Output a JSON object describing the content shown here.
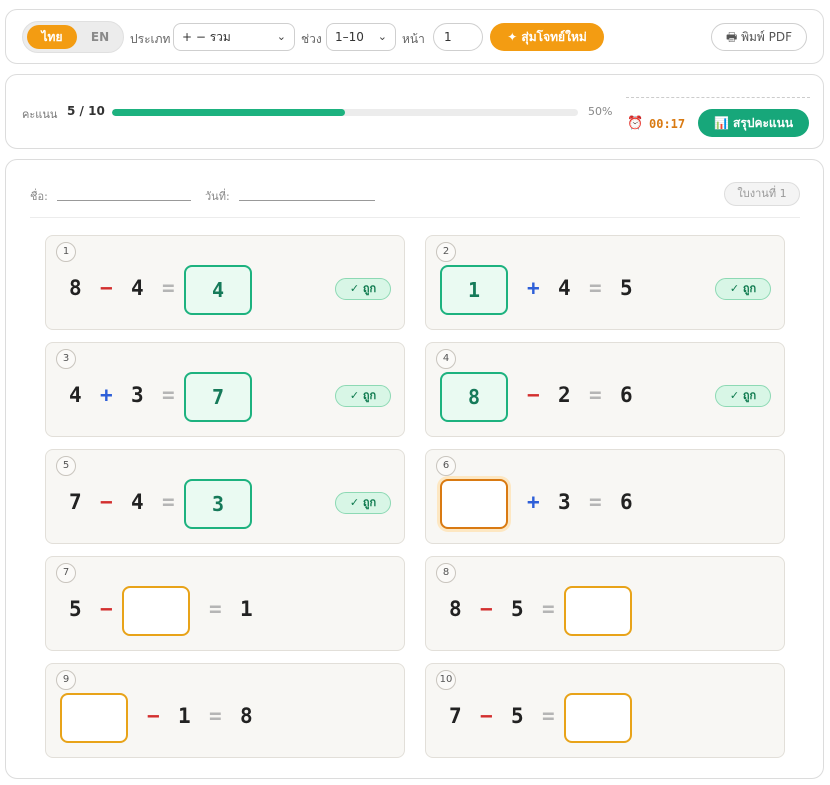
{
  "toolbar": {
    "lang_active": "ไทย",
    "lang_inactive": "EN",
    "type_label": "ประเภท",
    "type_value": "+ − รวม",
    "range_label": "ช่วง",
    "range_value": "1–10",
    "page_label": "หน้า",
    "page_value": "1",
    "random_button": "✦ สุ่มโจทย์ใหม่",
    "pdf_button": "🖶 พิมพ์ PDF"
  },
  "score": {
    "label": "คะแนน",
    "value": "5 / 10",
    "progress": 0.5,
    "percent_text": "50%",
    "timer_icon": "⏰",
    "timer": "00:17",
    "summary_button": "📊 สรุปคะแนน"
  },
  "sheet": {
    "name_label": "ชื่อ:",
    "date_label": "วันที่:",
    "badge": "ใบงานที่ 1",
    "correct_label": "✓ ถูก",
    "questions": [
      {
        "num": "1",
        "a": "8",
        "op": "−",
        "b": "4",
        "eq": "=",
        "result": "4",
        "answer": "4",
        "status": "correct"
      },
      {
        "num": "2",
        "a": "1",
        "op": "+",
        "b": "4",
        "eq": "=",
        "result": "5",
        "answer": "1",
        "status": "correct"
      },
      {
        "num": "3",
        "a": "4",
        "op": "+",
        "b": "3",
        "eq": "=",
        "result": "7",
        "answer": "7",
        "status": "correct"
      },
      {
        "num": "4",
        "a": "8",
        "op": "−",
        "b": "2",
        "eq": "=",
        "result": "6",
        "answer": "8",
        "status": "correct"
      },
      {
        "num": "5",
        "a": "7",
        "op": "−",
        "b": "4",
        "eq": "=",
        "result": "3",
        "answer": "3",
        "status": "correct"
      },
      {
        "num": "6",
        "a": "",
        "op": "+",
        "b": "3",
        "eq": "=",
        "result": "6",
        "answer": "",
        "status": "focused"
      },
      {
        "num": "7",
        "a": "5",
        "op": "−",
        "b": "",
        "eq": "=",
        "result": "1",
        "answer": "",
        "status": "empty"
      },
      {
        "num": "8",
        "a": "8",
        "op": "−",
        "b": "5",
        "eq": "=",
        "result": "",
        "answer": "",
        "status": "empty"
      },
      {
        "num": "9",
        "a": "",
        "op": "−",
        "b": "1",
        "eq": "=",
        "result": "8",
        "answer": "",
        "status": "empty"
      },
      {
        "num": "10",
        "a": "7",
        "op": "−",
        "b": "5",
        "eq": "=",
        "result": "",
        "answer": "",
        "status": "empty"
      }
    ]
  },
  "colors": {
    "accent": "#f39c12",
    "success": "#1db27f",
    "minus": "#d32f2f",
    "plus": "#2e5fd8"
  }
}
